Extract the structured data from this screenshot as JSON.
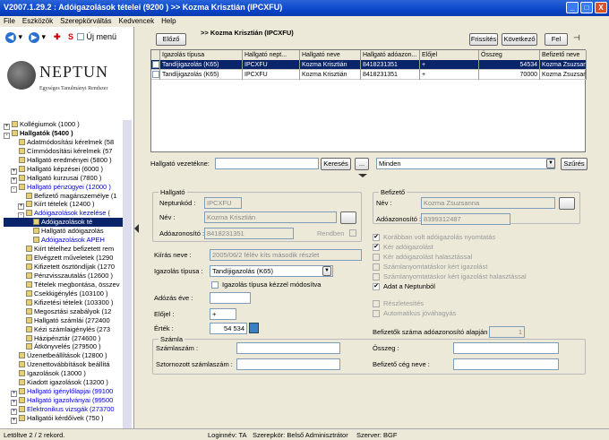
{
  "window": {
    "title": "V2007.1.29.2 : Adóigazolások tételei (9200  )  >> Kozma Krisztián (IPCXFU)",
    "min": "_",
    "max": "□",
    "close": "X"
  },
  "menu": [
    "File",
    "Eszközök",
    "Szerepkörváltás",
    "Kedvencek",
    "Help"
  ],
  "nav": {
    "new_menu_label": "Új menü",
    "s_label": "S"
  },
  "logo": {
    "name": "NEPTUN",
    "sub": "Egységes Tanulmányi Rendszer"
  },
  "tree": [
    {
      "label": "Kollégiumok (1000 )",
      "indent": 0,
      "pm": "+",
      "style": ""
    },
    {
      "label": "Hallgatók (5400  )",
      "indent": 0,
      "pm": "-",
      "style": "bold"
    },
    {
      "label": "Adatmódosítási kérelmek (58",
      "indent": 1,
      "pm": "",
      "style": ""
    },
    {
      "label": "Címmódosítási kérelmek (57",
      "indent": 1,
      "pm": "",
      "style": ""
    },
    {
      "label": "Hallgató eredményei (5800 )",
      "indent": 1,
      "pm": "",
      "style": ""
    },
    {
      "label": "Hallgató képzései (6000 )",
      "indent": 1,
      "pm": "+",
      "style": ""
    },
    {
      "label": "Hallgató kurzusai (7800 )",
      "indent": 1,
      "pm": "+",
      "style": ""
    },
    {
      "label": "Hallgató pénzügyei (12000 )",
      "indent": 1,
      "pm": "-",
      "style": "blue"
    },
    {
      "label": "Befizető magánszemélye (1",
      "indent": 2,
      "pm": "",
      "style": ""
    },
    {
      "label": "Kiírt tételek (12400 )",
      "indent": 2,
      "pm": "+",
      "style": ""
    },
    {
      "label": "Adóigazolások kezelése (",
      "indent": 2,
      "pm": "-",
      "style": "blue"
    },
    {
      "label": "Adóigazolások té",
      "indent": 3,
      "pm": "",
      "style": "sel"
    },
    {
      "label": "Hallgató adóigazolás",
      "indent": 3,
      "pm": "",
      "style": ""
    },
    {
      "label": "Adóigazolások APEH",
      "indent": 3,
      "pm": "",
      "style": "blue"
    },
    {
      "label": "Kiírt tételhez befizetett rem",
      "indent": 2,
      "pm": "",
      "style": ""
    },
    {
      "label": "Elvégzett műveletek (1290",
      "indent": 2,
      "pm": "",
      "style": ""
    },
    {
      "label": "Kifizetett ösztöndíjak (1270",
      "indent": 2,
      "pm": "",
      "style": ""
    },
    {
      "label": "Pénzvisszautalás (12600 )",
      "indent": 2,
      "pm": "",
      "style": ""
    },
    {
      "label": "Tételek megbontása, összev",
      "indent": 2,
      "pm": "",
      "style": ""
    },
    {
      "label": "Csekkigénylés (103100 )",
      "indent": 2,
      "pm": "",
      "style": ""
    },
    {
      "label": "Kifizetési tételek (103300 )",
      "indent": 2,
      "pm": "",
      "style": ""
    },
    {
      "label": "Megosztási szabályok (12",
      "indent": 2,
      "pm": "",
      "style": ""
    },
    {
      "label": "Hallgató számlái (272400",
      "indent": 2,
      "pm": "",
      "style": ""
    },
    {
      "label": "Kézi számlaigénylés (273",
      "indent": 2,
      "pm": "",
      "style": ""
    },
    {
      "label": "Házipénztár (274600 )",
      "indent": 2,
      "pm": "",
      "style": ""
    },
    {
      "label": "Átkönyvelés (279500 )",
      "indent": 2,
      "pm": "",
      "style": ""
    },
    {
      "label": "Üzenetbeállítások (12800 )",
      "indent": 1,
      "pm": "",
      "style": ""
    },
    {
      "label": "Üzenettovábbítások beállítá",
      "indent": 1,
      "pm": "",
      "style": ""
    },
    {
      "label": "Igazolások (13000 )",
      "indent": 1,
      "pm": "",
      "style": ""
    },
    {
      "label": "Kiadott igazolások (13200 )",
      "indent": 1,
      "pm": "",
      "style": ""
    },
    {
      "label": "Hallgató igénylőlapjai (99100",
      "indent": 1,
      "pm": "+",
      "style": "blue"
    },
    {
      "label": "Hallgató igazolványai (99500",
      "indent": 1,
      "pm": "+",
      "style": "blue"
    },
    {
      "label": "Elektronikus vizsgák (273700",
      "indent": 1,
      "pm": "+",
      "style": "blue"
    },
    {
      "label": "Hallgatói kérdőívek (750 )",
      "indent": 1,
      "pm": "+",
      "style": ""
    }
  ],
  "topbar": {
    "prev_button": "Előző",
    "header": ">> Kozma Krisztián (IPCXFU)",
    "refresh_button": "Frissítés",
    "next_button": "Következő",
    "up_button": "Fel",
    "pin": "⊣"
  },
  "grid": {
    "columns": [
      "Igazolás típusa",
      "Hallgató nept...",
      "Hallgató neve",
      "Hallgató adóazon...",
      "Előjel",
      "Összeg",
      "Befizető neve"
    ],
    "rows": [
      [
        "Tandíjigazolás (K65)",
        "IPCXFU",
        "Kozma Krisztián",
        "8418231351",
        "+",
        "54534",
        "Kozma Zsuzsan"
      ],
      [
        "Tandíjigazolás (K65)",
        "IPCXFU",
        "Kozma Krisztián",
        "8418231351",
        "+",
        "70000",
        "Kozma Zsuzsan"
      ]
    ]
  },
  "search": {
    "label": "Hallgató vezetékne:",
    "search_button": "Keresés",
    "dots_button": "...",
    "filter_value": "Minden",
    "filter_button": "Szűrés"
  },
  "form": {
    "hallgato_group": "Hallgató",
    "neptunkod_label": "Neptunkód :",
    "neptunkod_value": "IPCXFU",
    "nev_label": "Név :",
    "nev_value": "Kozma Krisztián",
    "adoazon_label": "Adóazonosító :",
    "adoazon_value": "8418231351",
    "rendben_label": "Rendben",
    "kiiras_label": "Kiírás neve :",
    "kiiras_value": "2005/06/2 félév kíts második részlet",
    "igtipus_label": "Igazolás típusa :",
    "igtipus_value": "Tandíjigazolás (K65)",
    "igtipus_check_label": "Igazolás típusa kézzel módosítva",
    "adozas_label": "Adózás éve :",
    "elojel_label": "Előjel :",
    "elojel_value": "+",
    "ertek_label": "Érték :",
    "ertek_value": "54 534",
    "befizeto_group": "Befizető",
    "bnev_label": "Név :",
    "bnev_value": "Kozma Zsuzsanna",
    "badoazon_label": "Adóazonosító :",
    "badoazon_value": "8399312487",
    "checks": [
      {
        "label": "Korábban volt adóigazolás nyomtatás",
        "checked": true
      },
      {
        "label": "Kér adóigazolást",
        "checked": true
      },
      {
        "label": "Kér adóigazolást halasztással",
        "checked": false
      },
      {
        "label": "Számlanyomtatáskor kért igazolást",
        "checked": false
      },
      {
        "label": "Számlanyomtatáskor kért igazolást halasztással",
        "checked": false
      },
      {
        "label": "Adat a Neptunból",
        "checked": true
      },
      {
        "label": "Részletesítés",
        "checked": false
      },
      {
        "label": "Automatikus jóváhagyás",
        "checked": false
      }
    ],
    "befizetok_szama_label": "Befizetők száma adóazonosító alapján :",
    "befizetok_szama_value": "1",
    "szamla_group": "Számla",
    "szamlaszam_label": "Számlaszám :",
    "osszeg_label": "Összeg :",
    "sztornozott_label": "Sztornozott számlaszám :",
    "befizeto_ceg_label": "Befizető cég neve :"
  },
  "status": {
    "record": "Letöltve 2 / 2 rekord.",
    "login": "Loginnév: TA",
    "role": "Szerepkör: Belső Adminisztrátor",
    "server": "Szerver: BGF"
  }
}
